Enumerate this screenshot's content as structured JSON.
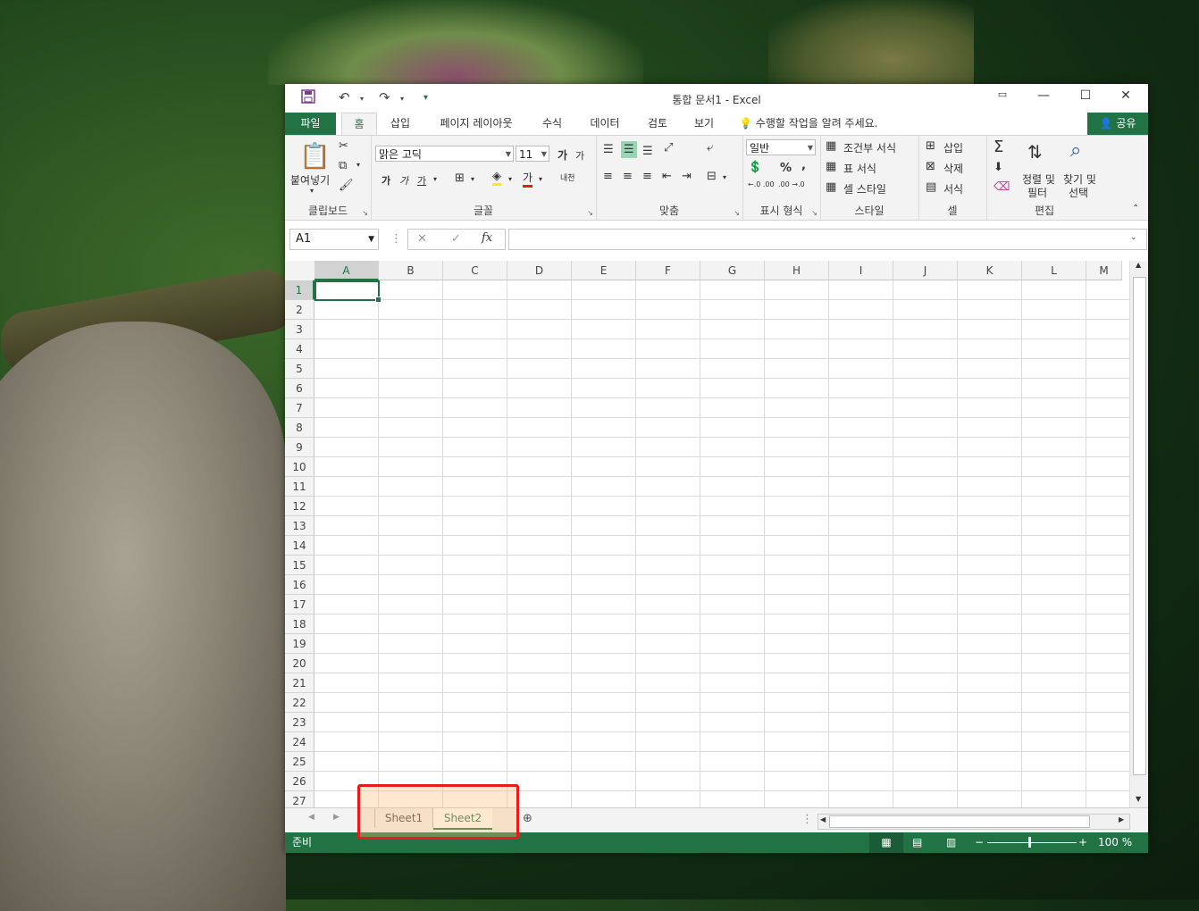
{
  "window": {
    "title": "통합 문서1 - Excel"
  },
  "qat": {
    "save_icon": "save-icon",
    "undo_icon": "undo-icon",
    "redo_icon": "redo-icon"
  },
  "tabs": [
    {
      "label": "파일"
    },
    {
      "label": "홈"
    },
    {
      "label": "삽입"
    },
    {
      "label": "페이지 레이아웃"
    },
    {
      "label": "수식"
    },
    {
      "label": "데이터"
    },
    {
      "label": "검토"
    },
    {
      "label": "보기"
    }
  ],
  "tell_me": "수행할 작업을 알려 주세요.",
  "share": "공유",
  "ribbon": {
    "clipboard": {
      "paste": "붙여넣기",
      "label": "클립보드"
    },
    "font": {
      "name": "맑은 고딕",
      "size": "11",
      "label": "글꼴",
      "grow": "가",
      "shrink": "가",
      "bold": "가",
      "italic": "가",
      "underline": "가",
      "color_letter": "가",
      "phonetic": "내천"
    },
    "alignment": {
      "label": "맞춤"
    },
    "number": {
      "format": "일반",
      "percent": "%",
      "comma": ",",
      "label": "표시 형식",
      "inc": "←.0 .00",
      "dec": ".00 →.0"
    },
    "styles": {
      "conditional": "조건부 서식",
      "table": "표 서식",
      "cell": "셀 스타일",
      "label": "스타일"
    },
    "cells": {
      "insert": "삽입",
      "delete": "삭제",
      "format": "서식",
      "label": "셀"
    },
    "editing": {
      "sum": "Σ",
      "sort1": "정렬 및",
      "sort2": "필터",
      "find1": "찾기 및",
      "find2": "선택",
      "label": "편집"
    }
  },
  "formula_bar": {
    "name_box": "A1",
    "cancel": "✕",
    "enter": "✓",
    "fx": "fx",
    "value": ""
  },
  "columns": [
    "A",
    "B",
    "C",
    "D",
    "E",
    "F",
    "G",
    "H",
    "I",
    "J",
    "K",
    "L",
    "M"
  ],
  "rows": [
    "1",
    "2",
    "3",
    "4",
    "5",
    "6",
    "7",
    "8",
    "9",
    "10",
    "11",
    "12",
    "13",
    "14",
    "15",
    "16",
    "17",
    "18",
    "19",
    "20",
    "21",
    "22",
    "23",
    "24",
    "25",
    "26",
    "27"
  ],
  "sheets": [
    {
      "name": "Sheet1"
    },
    {
      "name": "Sheet2"
    }
  ],
  "status": {
    "ready": "준비",
    "zoom": "100 %"
  }
}
